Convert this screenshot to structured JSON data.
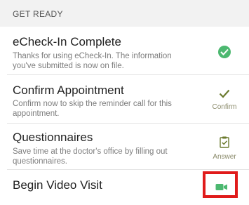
{
  "section": {
    "header": "GET READY"
  },
  "rows": [
    {
      "title": "eCheck-In Complete",
      "description": "Thanks for using eCheck-In. The information you've submitted is now on file.",
      "action_label": "",
      "icon": "check-circle-icon"
    },
    {
      "title": "Confirm Appointment",
      "description": "Confirm now to skip the reminder call for this appointment.",
      "action_label": "Confirm",
      "icon": "checkmark-icon"
    },
    {
      "title": "Questionnaires",
      "description": "Save time at the doctor's office by filling out questionnaires.",
      "action_label": "Answer",
      "icon": "clipboard-check-icon"
    },
    {
      "title": "Begin Video Visit",
      "description": "",
      "action_label": "",
      "icon": "video-camera-icon"
    }
  ],
  "colors": {
    "success_green": "#4cb870",
    "icon_olive": "#6b7a2e",
    "highlight_red": "#e01b1b"
  }
}
